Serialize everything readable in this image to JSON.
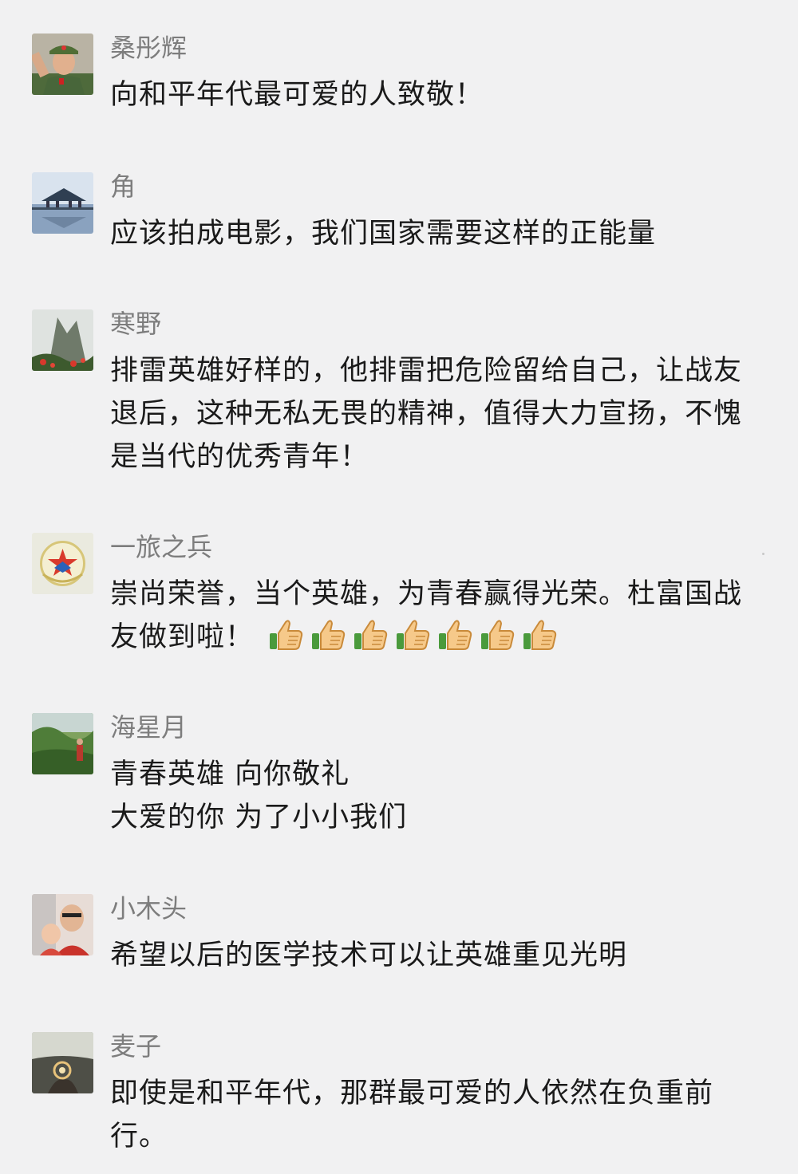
{
  "comments": [
    {
      "name": "桑彤辉",
      "text": "向和平年代最可爱的人致敬！",
      "avatar_icon": "soldier-portrait-icon"
    },
    {
      "name": "角",
      "text": "应该拍成电影，我们国家需要这样的正能量",
      "avatar_icon": "pavilion-lake-icon"
    },
    {
      "name": "寒野",
      "text": "排雷英雄好样的，他排雷把危险留给自己，让战友退后，这种无私无畏的精神，值得大力宣扬，不愧是当代的优秀青年！",
      "avatar_icon": "mountain-flowers-icon"
    },
    {
      "name": "一旅之兵",
      "text": "崇尚荣誉，当个英雄，为青春赢得光荣。杜富国战友做到啦！",
      "avatar_icon": "army-emblem-icon",
      "emoji_icon": "thumbs-up-icon",
      "emoji_count": 7
    },
    {
      "name": "海星月",
      "text": "青春英雄 向你敬礼\n大爱的你 为了小小我们",
      "avatar_icon": "forest-person-icon"
    },
    {
      "name": "小木头",
      "text": "希望以后的医学技术可以让英雄重见光明",
      "avatar_icon": "father-child-icon"
    },
    {
      "name": "麦子",
      "text": "即使是和平年代，那群最可爱的人依然在负重前行。",
      "avatar_icon": "ring-sunset-icon"
    }
  ],
  "colors": {
    "background": "#f1f1f2",
    "name": "#7d7d7d",
    "text": "#1a1a1a"
  }
}
